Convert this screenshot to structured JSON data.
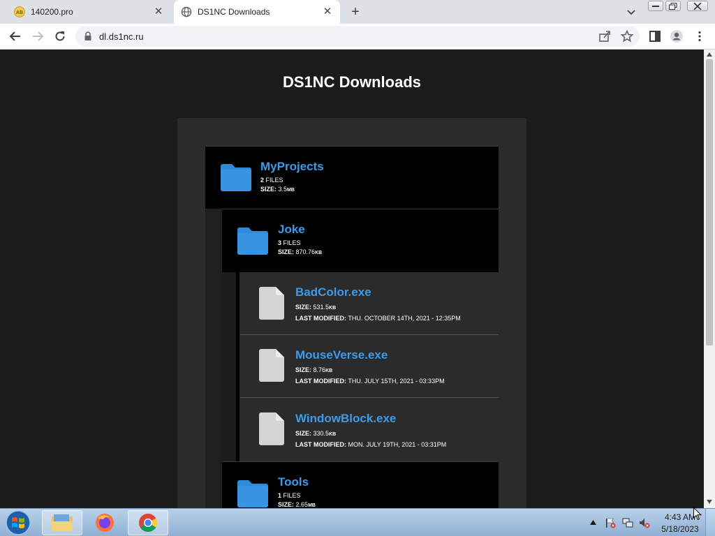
{
  "browser": {
    "tabs": [
      {
        "title": "140200.pro",
        "favicon": "ab-badge-icon",
        "active": false
      },
      {
        "title": "DS1NC Downloads",
        "favicon": "globe-icon",
        "active": true
      }
    ],
    "url": "dl.ds1nc.ru"
  },
  "page": {
    "title": "DS1NC Downloads",
    "folders": [
      {
        "name": "MyProjects",
        "files_count": "2",
        "files_label": "FILES",
        "size_label": "SIZE:",
        "size_value": "3.5",
        "size_unit": "MB"
      },
      {
        "name": "Joke",
        "files_count": "3",
        "files_label": "FILES",
        "size_label": "SIZE:",
        "size_value": "870.76",
        "size_unit": "KB"
      },
      {
        "name": "Tools",
        "files_count": "1",
        "files_label": "FILES",
        "size_label": "SIZE:",
        "size_value": "2.65",
        "size_unit": "MB"
      }
    ],
    "files": [
      {
        "name": "BadColor.exe",
        "size_label": "SIZE:",
        "size_value": "531.5",
        "size_unit": "KB",
        "modified_label": "LAST MODIFIED:",
        "modified_value": "THU. OCTOBER 14TH, 2021 - 12:35PM"
      },
      {
        "name": "MouseVerse.exe",
        "size_label": "SIZE:",
        "size_value": "8.76",
        "size_unit": "KB",
        "modified_label": "LAST MODIFIED:",
        "modified_value": "THU. JULY 15TH, 2021 - 03:33PM"
      },
      {
        "name": "WindowBlock.exe",
        "size_label": "SIZE:",
        "size_value": "330.5",
        "size_unit": "KB",
        "modified_label": "LAST MODIFIED:",
        "modified_value": "MON. JULY 19TH, 2021 - 03:31PM"
      }
    ]
  },
  "taskbar": {
    "time": "4:43 AM",
    "date": "5/18/2023",
    "apps": [
      "windows-explorer",
      "firefox",
      "chrome"
    ]
  },
  "colors": {
    "page_background": "#1b1b1b",
    "panel_background": "#2b2b2b",
    "folder_blue": "#2f8ad8",
    "link_blue": "#3d9be9",
    "file_gray": "#d4d4d4"
  }
}
